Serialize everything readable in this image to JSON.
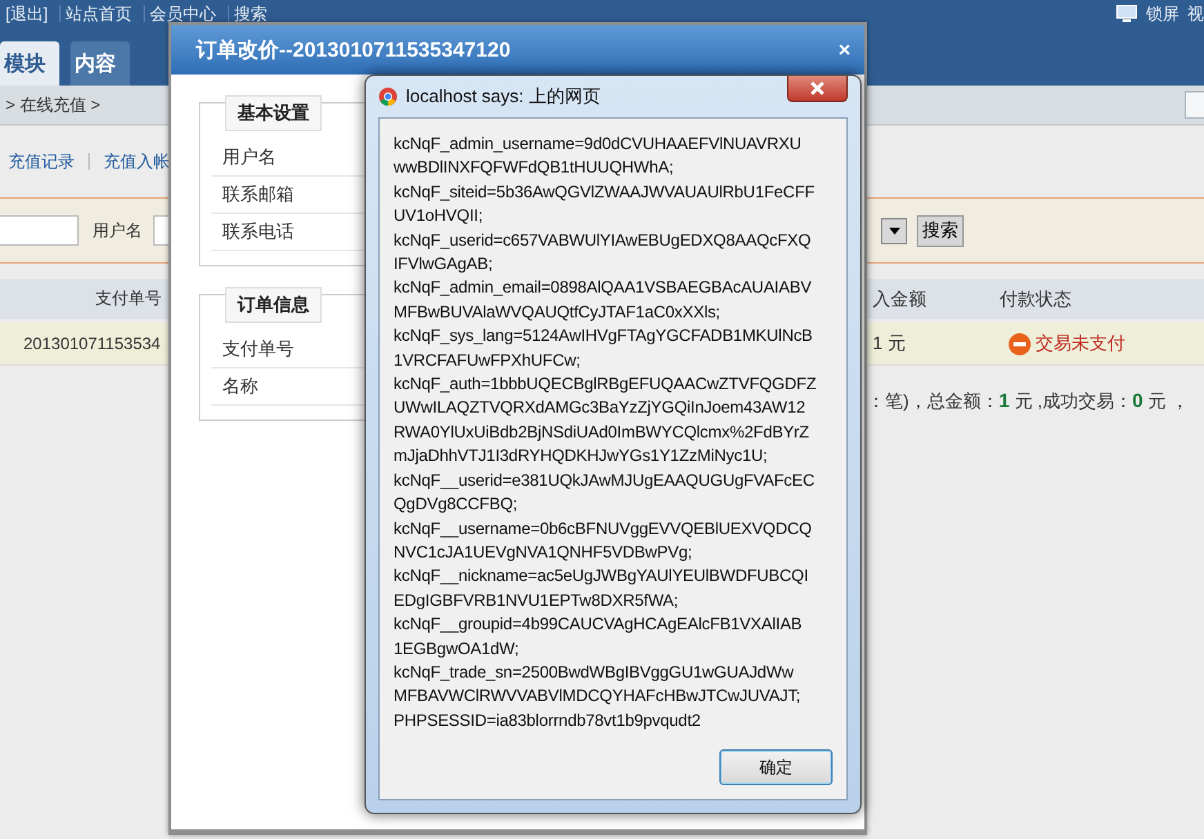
{
  "top_bar": {
    "links": [
      "[退出]",
      "站点首页",
      "会员中心",
      "搜索"
    ],
    "right_links": [
      "锁屏",
      "视"
    ]
  },
  "header": {
    "tabs": [
      {
        "label": "模块",
        "selected": true
      },
      {
        "label": "内容",
        "selected": false
      }
    ]
  },
  "breadcrumb": {
    "text": "> 在线充值 >"
  },
  "sub_links": [
    "充值记录",
    "充值入帐"
  ],
  "filter": {
    "label": "用户名",
    "search_button": "搜索"
  },
  "table": {
    "columns": [
      "支付单号",
      "入金额",
      "付款状态"
    ],
    "rows": [
      {
        "order_no": "201301071153534",
        "amount": "1 元",
        "status": "交易未支付"
      }
    ]
  },
  "summary": "：笔)，总金额：**1** 元 ,成功交易：**0** 元 ，",
  "order_dialog": {
    "title": "订单改价--2013010711535347120",
    "close": "×",
    "sections": [
      {
        "legend": "基本设置",
        "fields": [
          "用户名",
          "联系邮箱",
          "联系电话"
        ]
      },
      {
        "legend": "订单信息",
        "fields": [
          "支付单号",
          "名称"
        ]
      }
    ]
  },
  "alert": {
    "title": "localhost says: 上的网页",
    "message_lines": [
      "kcNqF_admin_username=9d0dCVUHAAEFVlNUAVRXU",
      "wwBDlINXFQFWFdQB1tHUUQHWhA;",
      "kcNqF_siteid=5b36AwQGVlZWAAJWVAUAUlRbU1FeCFF",
      "UV1oHVQII;",
      "kcNqF_userid=c657VABWUlYIAwEBUgEDXQ8AAQcFXQ",
      "IFVlwGAgAB;",
      "kcNqF_admin_email=0898AlQAA1VSBAEGBAcAUAIABV",
      "MFBwBUVAlaWVQAUQtfCyJTAF1aC0xXXls;",
      "kcNqF_sys_lang=5124AwIHVgFTAgYGCFADB1MKUlNcB",
      "1VRCFAFUwFPXhUFCw;",
      "kcNqF_auth=1bbbUQECBglRBgEFUQAACwZTVFQGDFZ",
      "UWwILAQZTVQRXdAMGc3BaYzZjYGQiInJoem43AW12",
      "RWA0YlUxUiBdb2BjNSdiUAd0ImBWYCQlcmx%2FdBYrZ",
      "mJjaDhhVTJ1I3dRYHQDKHJwYGs1Y1ZzMiNyc1U;",
      "kcNqF__userid=e381UQkJAwMJUgEAAQUGUgFVAFcEC",
      "QgDVg8CCFBQ;",
      "kcNqF__username=0b6cBFNUVggEVVQEBlUEXVQDCQ",
      "NVC1cJA1UEVgNVA1QNHF5VDBwPVg;",
      "kcNqF__nickname=ac5eUgJWBgYAUlYEUlBWDFUBCQI",
      "EDgIGBFVRB1NVU1EPTw8DXR5fWA;",
      "kcNqF__groupid=4b99CAUCVAgHCAgEAlcFB1VXAlIAB",
      "1EGBgwOA1dW;",
      "kcNqF_trade_sn=2500BwdWBgIBVggGU1wGUAJdWw",
      "MFBAVWClRWVVABVlMDCQYHAFcHBwJTCwJUVAJT;",
      "PHPSESSID=ia83blorrndb78vt1b9pvqudt2"
    ],
    "ok_button": "确定"
  }
}
